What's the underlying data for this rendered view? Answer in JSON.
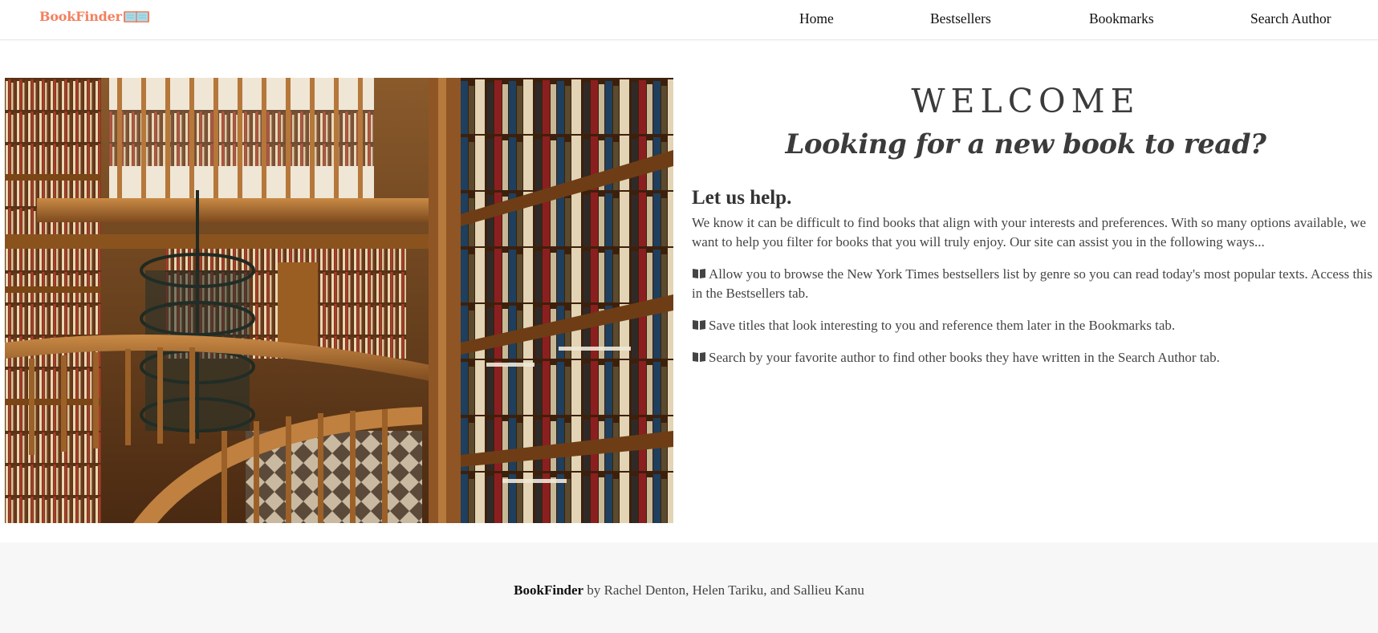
{
  "brand": {
    "name": "BookFinder",
    "color": "#f4805f"
  },
  "nav": {
    "items": [
      {
        "label": "Home"
      },
      {
        "label": "Bestsellers"
      },
      {
        "label": "Bookmarks"
      },
      {
        "label": "Search Author"
      }
    ]
  },
  "hero": {
    "image": "library-interior-photo"
  },
  "main": {
    "welcome": "WELCOME",
    "tagline": "Looking for a new book to read?",
    "help_title": "Let us help.",
    "intro": "We know it can be difficult to find books that align with your interests and preferences. With so many options available, we want to help you filter for books that you will truly enjoy. Our site can assist you in the following ways...",
    "features": [
      {
        "icon": "book-open-icon",
        "text": "Allow you to browse the New York Times bestsellers list by genre so you can read today's most popular texts. Access this in the Bestsellers tab."
      },
      {
        "icon": "book-open-icon",
        "text": "Save titles that look interesting to you and reference them later in the Bookmarks tab."
      },
      {
        "icon": "book-open-icon",
        "text": "Search by your favorite author to find other books they have written in the Search Author tab."
      }
    ]
  },
  "footer": {
    "brand": "BookFinder",
    "credits": "by Rachel Denton, Helen Tariku, and Sallieu Kanu"
  },
  "colors": {
    "text": "#444444",
    "footer_bg": "#f7f7f7",
    "nav_border": "#e9e9e9"
  }
}
